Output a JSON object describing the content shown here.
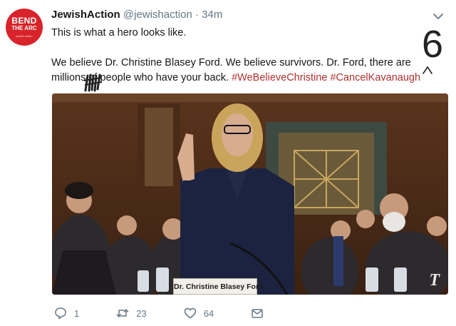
{
  "avatar": {
    "line1": "BEND",
    "line2": "THE ARC",
    "line3": "jewish action",
    "color": "#d8232a"
  },
  "tweet": {
    "display_name": "JewishAction",
    "handle": "@jewishaction",
    "separator": "·",
    "time": "34m",
    "text_line1": "This is what a hero looks like.",
    "text_line2": "We believe Dr. Christine Blasey Ford. We believe survivors. Dr. Ford, there are millions of people who have your back.",
    "hashtags": [
      "#WeBelieveChristine",
      "#CancelKavanaugh"
    ],
    "hashtag_color": "#b03030"
  },
  "media": {
    "nameplate": "Dr. Christine Blasey Ford",
    "watermark": "T"
  },
  "annotations": {
    "margin_number": "6"
  },
  "actions": {
    "reply_count": "1",
    "retweet_count": "23",
    "like_count": "64"
  },
  "icons": [
    "chevron-down-icon",
    "reply-icon",
    "retweet-icon",
    "like-icon",
    "message-icon"
  ],
  "colors": {
    "secondary_text": "#657786",
    "primary_text": "#14171a"
  }
}
